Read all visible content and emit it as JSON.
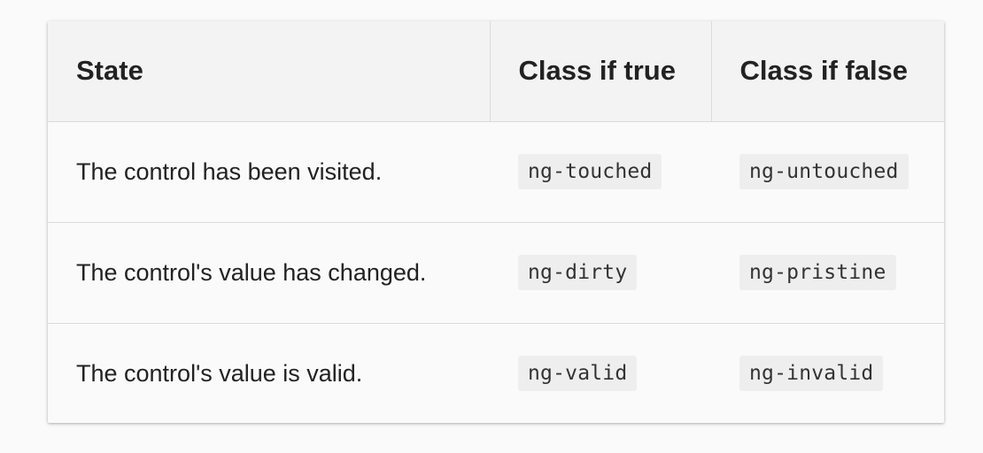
{
  "table": {
    "headers": [
      "State",
      "Class if true",
      "Class if false"
    ],
    "rows": [
      {
        "state": "The control has been visited.",
        "class_true": "ng-touched",
        "class_false": "ng-untouched"
      },
      {
        "state": "The control's value has changed.",
        "class_true": "ng-dirty",
        "class_false": "ng-pristine"
      },
      {
        "state": "The control's value is valid.",
        "class_true": "ng-valid",
        "class_false": "ng-invalid"
      }
    ]
  }
}
